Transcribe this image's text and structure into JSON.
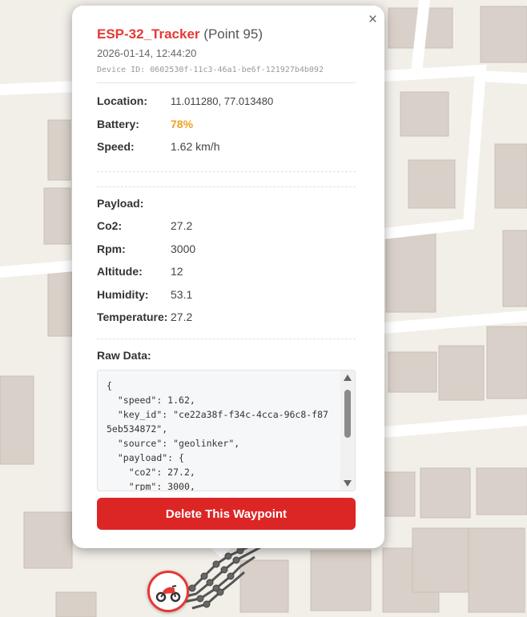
{
  "popup": {
    "device_name": "ESP-32_Tracker",
    "point_label": "(Point 95)",
    "timestamp": "2026-01-14, 12:44:20",
    "device_id": "Device ID: 0602530f-11c3-46a1-be6f-121927b4b092",
    "close_glyph": "×",
    "fields": [
      {
        "label": "Location:",
        "value": "11.011280, 77.013480",
        "color": "#444444"
      },
      {
        "label": "Battery:",
        "value": "78%",
        "color": "#f0a020"
      },
      {
        "label": "Speed:",
        "value": "1.62 km/h",
        "color": "#444444"
      }
    ],
    "payload_label": "Payload:",
    "payload": [
      {
        "label": "Co2:",
        "value": "27.2"
      },
      {
        "label": "Rpm:",
        "value": "3000"
      },
      {
        "label": "Altitude:",
        "value": "12"
      },
      {
        "label": "Humidity:",
        "value": "53.1"
      },
      {
        "label": "Temperature:",
        "value": "27.2"
      }
    ],
    "raw_label": "Raw Data:",
    "raw_text": "{\n  \"speed\": 1.62,\n  \"key_id\": \"ce22a38f-f34c-4cca-96c8-f875eb534872\",\n  \"source\": \"geolinker\",\n  \"payload\": {\n    \"co2\": 27.2,\n    \"rpm\": 3000,",
    "delete_label": "Delete This Waypoint"
  },
  "marker": {
    "icon": "motorcycle-icon",
    "color": "#e53935"
  },
  "colors": {
    "accent": "#e53935",
    "delete": "#dc2626",
    "battery": "#f0a020",
    "map_bg": "#f2efe9",
    "building": "#d9d0c9"
  }
}
